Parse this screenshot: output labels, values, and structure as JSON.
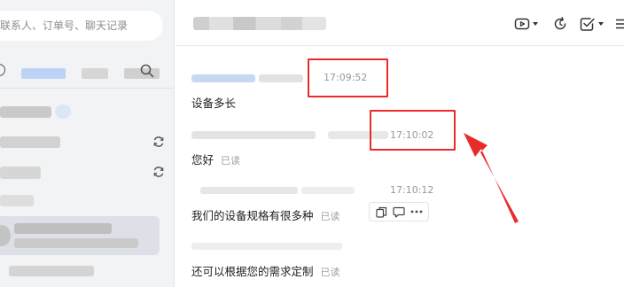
{
  "sidebar": {
    "search": {
      "placeholder": "联系人、订单号、聊天记录"
    }
  },
  "messages": [
    {
      "time": "17:09:52",
      "text": "设备多长",
      "read": ""
    },
    {
      "time": "17:10:02",
      "text": "您好",
      "read": "已读"
    },
    {
      "time": "17:10:12",
      "text": "我们的设备规格有很多种",
      "read": "已读"
    },
    {
      "time": "",
      "text": "还可以根据您的需求定制",
      "read": "已读"
    }
  ],
  "colors": {
    "highlight": "#ea2b2b",
    "sidebar_bg": "#f2f3f5",
    "selected_item_bg": "#dde0e6",
    "tab_accent": "#bcd3f5"
  },
  "icons": {
    "toolbar": [
      "video-call-icon",
      "refresh-icon",
      "checkbox-icon",
      "menu-icon"
    ],
    "message_actions": [
      "copy-icon",
      "quote-icon",
      "more-icon"
    ]
  }
}
